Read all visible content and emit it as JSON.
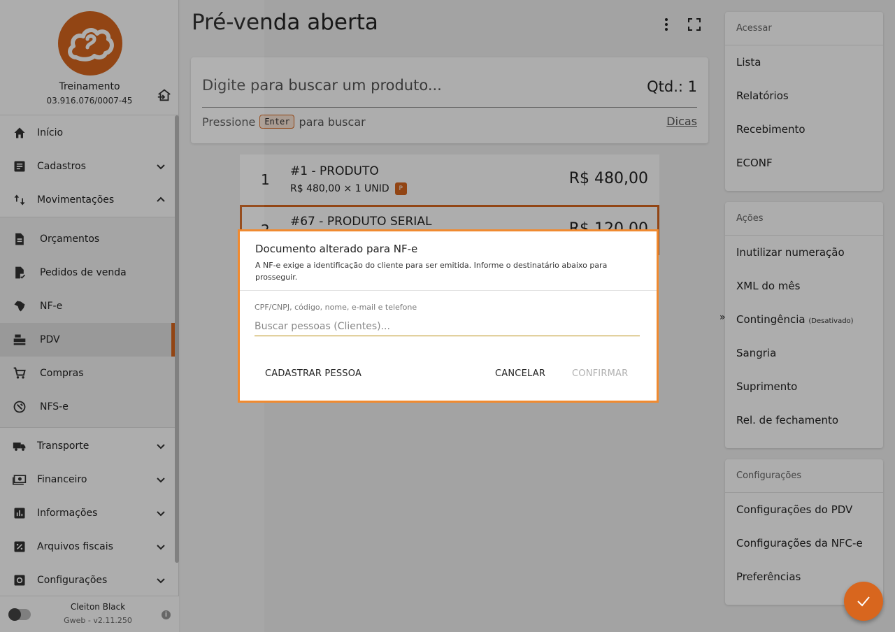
{
  "company": {
    "name": "Treinamento",
    "document": "03.916.076/0007-45"
  },
  "nav": {
    "inicio": "Início",
    "cadastros": "Cadastros",
    "movimentacoes": "Movimentações",
    "orcamentos": "Orçamentos",
    "pedidos": "Pedidos de venda",
    "nfe": "NF-e",
    "pdv": "PDV",
    "compras": "Compras",
    "nfse": "NFS-e",
    "transporte": "Transporte",
    "financeiro": "Financeiro",
    "informacoes": "Informações",
    "arquivos": "Arquivos fiscais",
    "configuracoes": "Configurações"
  },
  "footer": {
    "user": "Cleiton Black",
    "version": "Gweb - v2.11.250"
  },
  "main": {
    "title": "Pré-venda aberta",
    "search_placeholder": "Digite para buscar um produto...",
    "qty_label": "Qtd.: 1",
    "hint_before": "Pressione",
    "hint_key": "Enter",
    "hint_after": "para buscar",
    "tips": "Dicas"
  },
  "products": [
    {
      "index": "1",
      "name": "#1 - PRODUTO",
      "detail": "R$ 480,00 × 1 UNID",
      "badge": "P",
      "price": "R$ 480,00"
    },
    {
      "index": "2",
      "name": "#67 - PRODUTO SERIAL",
      "price": "R$ 120,00"
    }
  ],
  "right": {
    "acessar": {
      "header": "Acessar",
      "items": [
        "Lista",
        "Relatórios",
        "Recebimento",
        "ECONF"
      ]
    },
    "acoes": {
      "header": "Ações",
      "items": [
        "Inutilizar numeração",
        "XML do mês",
        "Contingência",
        "Sangria",
        "Suprimento",
        "Rel. de fechamento"
      ],
      "contingencia_note": "(Desativado)"
    },
    "config": {
      "header": "Configurações",
      "items": [
        "Configurações do PDV",
        "Configurações da NFC-e",
        "Preferências"
      ]
    }
  },
  "dialog": {
    "title": "Documento alterado para NF-e",
    "message": "A NF-e exige a identificação do cliente para ser emitida. Informe o destinatário abaixo para prosseguir.",
    "field_label": "CPF/CNPJ, código, nome, e-mail e telefone",
    "field_placeholder": "Buscar pessoas (Clientes)...",
    "btn_register": "CADASTRAR PESSOA",
    "btn_cancel": "CANCELAR",
    "btn_confirm": "CONFIRMAR"
  },
  "colors": {
    "accent": "#d8661e",
    "dialog_border": "#f08a30"
  }
}
